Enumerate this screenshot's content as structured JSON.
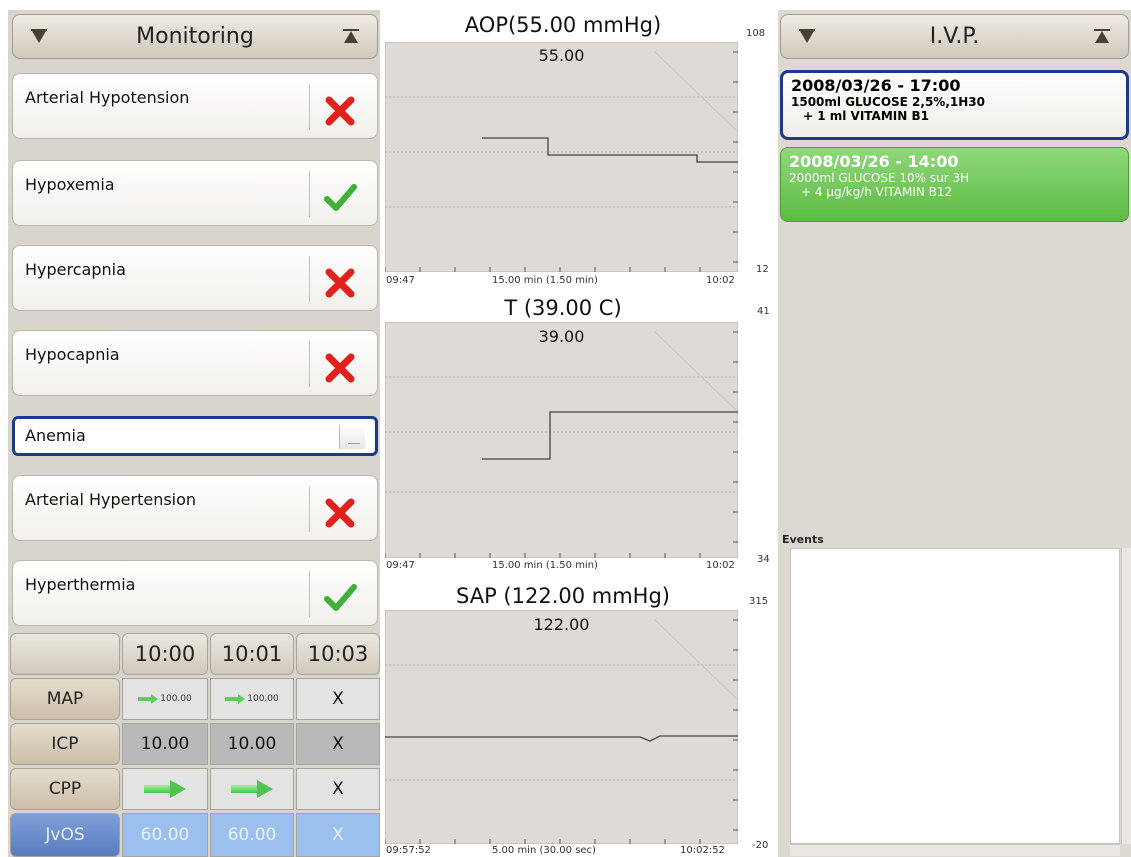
{
  "monitoring": {
    "title": "Monitoring",
    "alarms": [
      {
        "label": "Arterial Hypotension",
        "status": "cross"
      },
      {
        "label": "Hypoxemia",
        "status": "check"
      },
      {
        "label": "Hypercapnia",
        "status": "cross"
      },
      {
        "label": "Hypocapnia",
        "status": "cross"
      },
      {
        "label": "Anemia",
        "status": "unknown"
      },
      {
        "label": "Arterial Hypertension",
        "status": "cross"
      },
      {
        "label": "Hyperthermia",
        "status": "check"
      }
    ]
  },
  "trend_grid": {
    "times": [
      "10:00",
      "10:01",
      "10:03"
    ],
    "rows": [
      {
        "label": "MAP",
        "cells": [
          "100.00",
          "100.00",
          "X"
        ]
      },
      {
        "label": "ICP",
        "cells": [
          "10.00",
          "10.00",
          "X"
        ]
      },
      {
        "label": "CPP",
        "cells": [
          "",
          "",
          "X"
        ]
      },
      {
        "label": "JvOS",
        "cells": [
          "60.00",
          "60.00",
          "X"
        ]
      }
    ]
  },
  "charts": [
    {
      "title": "AOP(55.00 mmHg)",
      "current": "55.00",
      "scale_max": "108",
      "scale_min": "12",
      "x_start": "09:47",
      "x_window": "15.00 min (1.50 min)",
      "x_end": "10:02"
    },
    {
      "title": "T (39.00 C)",
      "current": "39.00",
      "scale_max": "41",
      "scale_min": "34",
      "x_start": "09:47",
      "x_window": "15.00 min (1.50 min)",
      "x_end": "10:02"
    },
    {
      "title": "SAP (122.00 mmHg)",
      "current": "122.00",
      "scale_max": "315",
      "scale_min": "-20",
      "x_start": "09:57:52",
      "x_window": "5.00 min (30.00 sec)",
      "x_end": "10:02:52"
    }
  ],
  "ivp": {
    "title": "I.V.P.",
    "entries": [
      {
        "date": "2008/03/26 - 17:00",
        "line1": "1500ml GLUCOSE 2,5%,1H30",
        "line2": "+ 1 ml VITAMIN B1"
      },
      {
        "date": "2008/03/26 - 14:00",
        "line1": "2000ml GLUCOSE 10% sur 3H",
        "line2": "+ 4 μg/kg/h  VITAMIN B12"
      }
    ],
    "events_label": "Events"
  },
  "colors": {
    "selected_border": "#1d3a8a",
    "active_green": "#68c54e",
    "cross": "#e0211c",
    "check": "#3fb13a"
  }
}
